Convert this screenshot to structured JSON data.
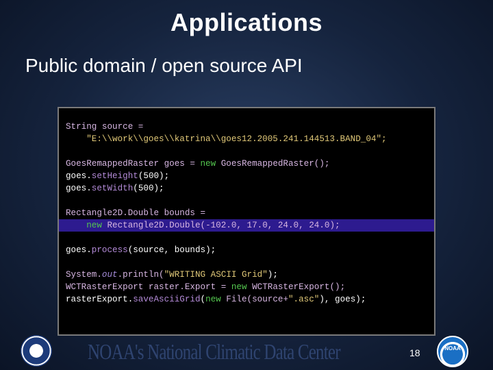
{
  "slide": {
    "title": "Applications",
    "subtitle": "Public domain / open source API",
    "page_number": "18",
    "footer_brand": "NOAA's National Climatic Data Center",
    "noaa_mark": "NOAA"
  },
  "code": {
    "l1a": "String source =",
    "l2a": "    \"E:\\\\work\\\\goes\\\\katrina\\\\goes12.2005.241.144513.BAND_04\";",
    "l4a": "GoesRemappedRaster goes = ",
    "l4b": "new",
    "l4c": " GoesRemappedRaster();",
    "l5a": "goes.",
    "l5b": "setHeight",
    "l5c": "(500);",
    "l6a": "goes.",
    "l6b": "setWidth",
    "l6c": "(500);",
    "l8a": "Rectangle2D.Double bounds =",
    "l9a": "    ",
    "l9b": "new",
    "l9c": " Rectangle2D.Double(-102.0, 17.0, 24.0, 24.0);",
    "l11a": "goes.",
    "l11b": "process",
    "l11c": "(source, bounds);",
    "l13a": "System.",
    "l13b": "out",
    "l13c": ".println(",
    "l13d": "\"WRITING ASCII Grid\"",
    "l13e": ");",
    "l14a": "WCTRasterExport raster.Export = ",
    "l14b": "new",
    "l14c": " WCTRasterExport();",
    "l15a": "rasterExport.",
    "l15b": "saveAsciiGrid",
    "l15c": "(",
    "l15d": "new",
    "l15e": " File(source+",
    "l15f": "\".asc\"",
    "l15g": "), goes);"
  }
}
